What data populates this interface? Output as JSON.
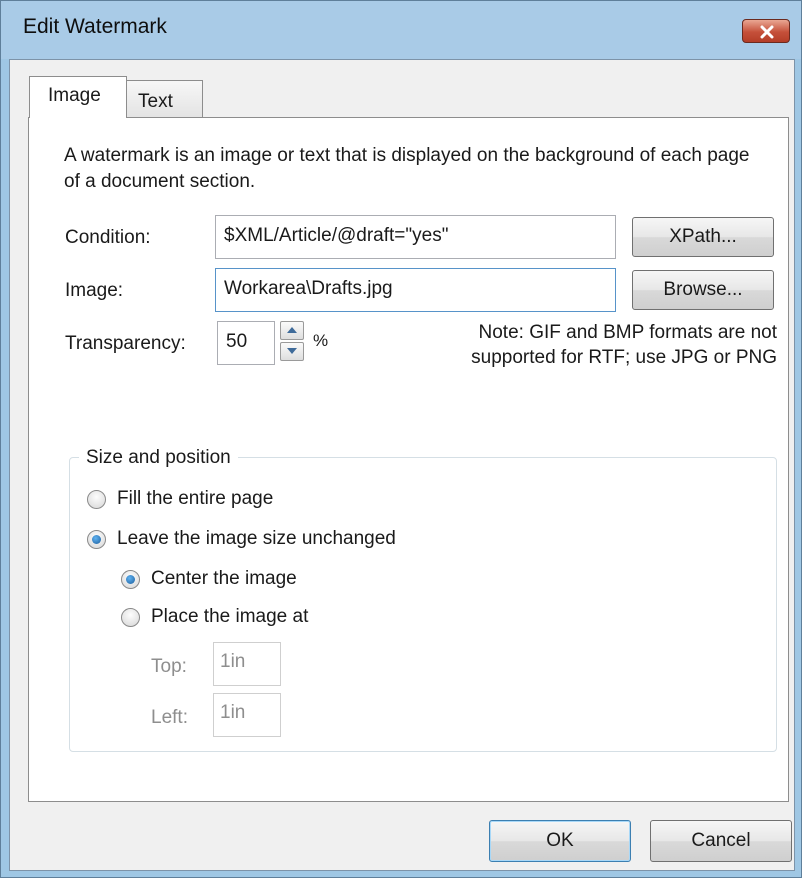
{
  "window": {
    "title": "Edit Watermark"
  },
  "tabs": [
    {
      "label": "Image",
      "active": true
    },
    {
      "label": "Text",
      "active": false
    }
  ],
  "description": "A watermark is an image or text that is displayed on the background of each page of a document section.",
  "condition": {
    "label": "Condition:",
    "value": "$XML/Article/@draft=\"yes\"",
    "button": "XPath..."
  },
  "image": {
    "label": "Image:",
    "value": "Workarea\\Drafts.jpg",
    "button": "Browse..."
  },
  "transparency": {
    "label": "Transparency:",
    "value": "50",
    "unit": "%"
  },
  "note": {
    "line1": "Note: GIF and BMP formats are not",
    "line2": "supported for RTF; use JPG or PNG"
  },
  "size_position": {
    "title": "Size and position",
    "fill_page": {
      "label": "Fill the entire page",
      "checked": false
    },
    "leave_unchanged": {
      "label": "Leave the image size unchanged",
      "checked": true
    },
    "center": {
      "label": "Center the image",
      "checked": true
    },
    "place_at": {
      "label": "Place the image at",
      "checked": false
    },
    "top": {
      "label": "Top:",
      "value": "1in"
    },
    "left": {
      "label": "Left:",
      "value": "1in"
    }
  },
  "buttons": {
    "ok": "OK",
    "cancel": "Cancel"
  },
  "icons": {
    "close": "close-icon",
    "up": "arrow-up-icon",
    "down": "arrow-down-icon"
  },
  "colors": {
    "close_button": "#c5503a",
    "titlebar": "#a9cbe7",
    "radio_checked": "#1d5f9d"
  }
}
